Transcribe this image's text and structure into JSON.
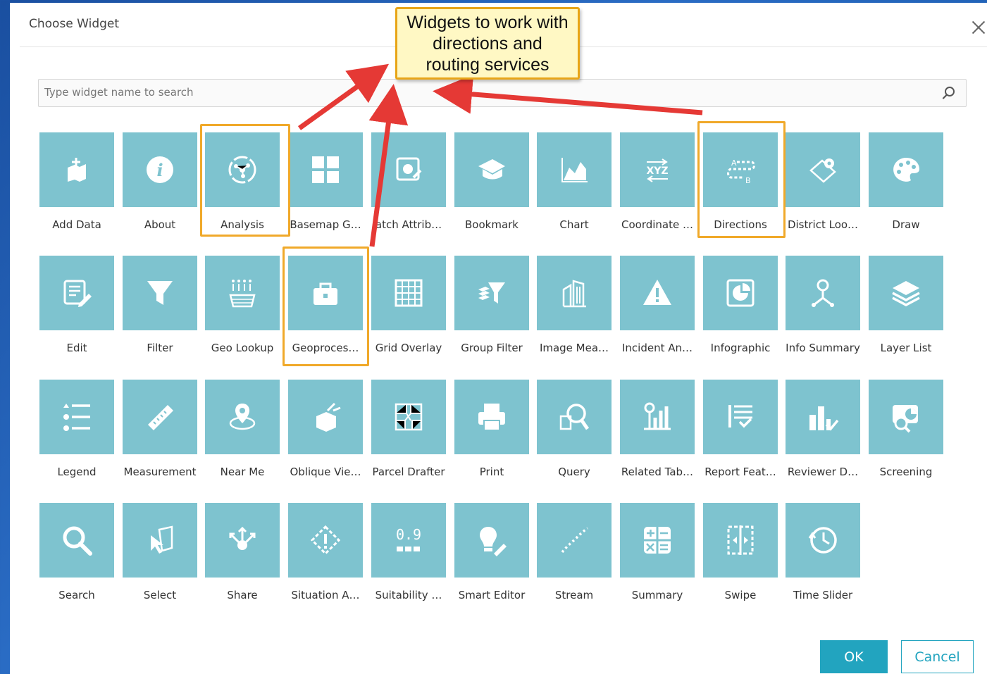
{
  "dialog": {
    "title": "Choose Widget",
    "search_placeholder": "Type widget name to search",
    "ok_label": "OK",
    "cancel_label": "Cancel"
  },
  "colors": {
    "tile": "#7ec3cf",
    "highlight": "#f0a92a",
    "ok_button": "#22a4bf",
    "arrow": "#e53935"
  },
  "callout": {
    "lines": [
      "Widgets to work with",
      "directions and",
      "routing services"
    ]
  },
  "widgets": [
    {
      "label": "Add Data",
      "icon": "add-data-icon"
    },
    {
      "label": "About",
      "icon": "info-icon"
    },
    {
      "label": "Analysis",
      "icon": "analysis-icon",
      "highlighted": true
    },
    {
      "label": "Basemap G…",
      "icon": "basemap-gallery-icon"
    },
    {
      "label": "atch Attrib…",
      "icon": "batch-attribute-icon"
    },
    {
      "label": "Bookmark",
      "icon": "bookmark-icon"
    },
    {
      "label": "Chart",
      "icon": "chart-icon"
    },
    {
      "label": "Coordinate …",
      "icon": "coordinate-icon"
    },
    {
      "label": "Directions",
      "icon": "directions-icon",
      "highlighted": true
    },
    {
      "label": "District Loo…",
      "icon": "district-lookup-icon"
    },
    {
      "label": "Draw",
      "icon": "draw-icon"
    },
    {
      "label": "Edit",
      "icon": "edit-icon"
    },
    {
      "label": "Filter",
      "icon": "filter-icon"
    },
    {
      "label": "Geo Lookup",
      "icon": "geo-lookup-icon"
    },
    {
      "label": "Geoproces…",
      "icon": "geoprocessing-icon",
      "highlighted": true
    },
    {
      "label": "Grid Overlay",
      "icon": "grid-overlay-icon"
    },
    {
      "label": "Group Filter",
      "icon": "group-filter-icon"
    },
    {
      "label": "Image Mea…",
      "icon": "image-measurement-icon"
    },
    {
      "label": "Incident An…",
      "icon": "incident-analysis-icon"
    },
    {
      "label": "Infographic",
      "icon": "infographic-icon"
    },
    {
      "label": "Info Summary",
      "icon": "info-summary-icon"
    },
    {
      "label": "Layer List",
      "icon": "layer-list-icon"
    },
    {
      "label": "Legend",
      "icon": "legend-icon"
    },
    {
      "label": "Measurement",
      "icon": "ruler-icon"
    },
    {
      "label": "Near Me",
      "icon": "near-me-icon"
    },
    {
      "label": "Oblique Vie…",
      "icon": "oblique-viewer-icon"
    },
    {
      "label": "Parcel Drafter",
      "icon": "parcel-drafter-icon"
    },
    {
      "label": "Print",
      "icon": "printer-icon"
    },
    {
      "label": "Query",
      "icon": "query-icon"
    },
    {
      "label": "Related Tab…",
      "icon": "related-table-icon"
    },
    {
      "label": "Report Feat…",
      "icon": "report-feature-icon"
    },
    {
      "label": "Reviewer D…",
      "icon": "reviewer-dashboard-icon"
    },
    {
      "label": "Screening",
      "icon": "screening-icon"
    },
    {
      "label": "Search",
      "icon": "search-icon"
    },
    {
      "label": "Select",
      "icon": "select-icon"
    },
    {
      "label": "Share",
      "icon": "share-icon"
    },
    {
      "label": "Situation A…",
      "icon": "situation-awareness-icon"
    },
    {
      "label": "Suitability …",
      "icon": "suitability-icon"
    },
    {
      "label": "Smart Editor",
      "icon": "smart-editor-icon"
    },
    {
      "label": "Stream",
      "icon": "stream-icon"
    },
    {
      "label": "Summary",
      "icon": "summary-icon"
    },
    {
      "label": "Swipe",
      "icon": "swipe-icon"
    },
    {
      "label": "Time Slider",
      "icon": "clock-icon"
    }
  ]
}
